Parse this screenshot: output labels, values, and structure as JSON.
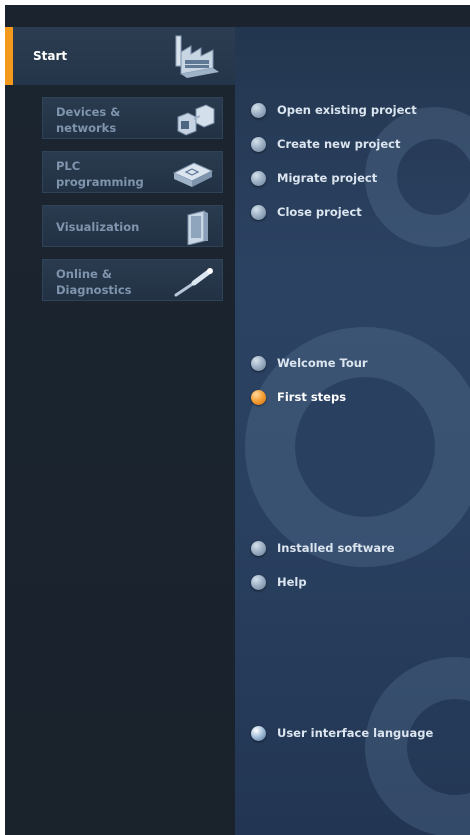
{
  "start": {
    "label": "Start",
    "icon": "factory-icon"
  },
  "nav": [
    {
      "line1": "Devices &",
      "line2": "networks",
      "icon": "devices-networks-icon"
    },
    {
      "line1": "PLC",
      "line2": "programming",
      "icon": "plc-icon"
    },
    {
      "line1": "Visualization",
      "line2": "",
      "icon": "visualization-panel-icon"
    },
    {
      "line1": "Online &",
      "line2": "Diagnostics",
      "icon": "diagnostics-probe-icon"
    }
  ],
  "actions": {
    "open_project": "Open existing project",
    "create_project": "Create new project",
    "migrate_project": "Migrate project",
    "close_project": "Close project",
    "welcome_tour": "Welcome Tour",
    "first_steps": "First steps",
    "installed_software": "Installed software",
    "help": "Help",
    "ui_language": "User interface language"
  },
  "colors": {
    "accent": "#f39a1d",
    "active_bullet": "#f6a23a",
    "left_background": "#1a232e",
    "right_background": "#2a4060"
  }
}
